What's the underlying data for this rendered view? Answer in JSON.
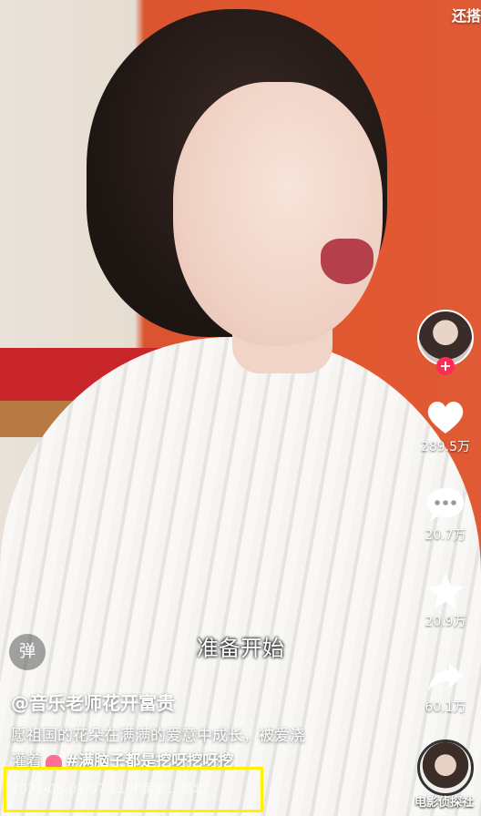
{
  "top_right_label": "还搭",
  "rail": {
    "likes": "289.5万",
    "comments": "20.7万",
    "favorites": "20.9万",
    "shares": "60.1万",
    "follow_symbol": "+"
  },
  "danmu_label": "弹",
  "subtitle": "准备开始",
  "post": {
    "author": "@音乐老师花开富贵",
    "description_1": "愿祖国的花朵在满满的爱意中成长，被爱浇",
    "description_2": "灌着",
    "hashtag": "#满脑子都是挖呀挖呀挖",
    "timestamp": "2023-05-01 07:11",
    "ip_location": "IP属地：湖北"
  },
  "watermark": "电影侦探社",
  "colors": {
    "highlight_box": "#fff200",
    "follow_badge": "#fe2c55"
  },
  "icons": [
    "heart-icon",
    "comment-icon",
    "star-icon",
    "share-icon"
  ]
}
